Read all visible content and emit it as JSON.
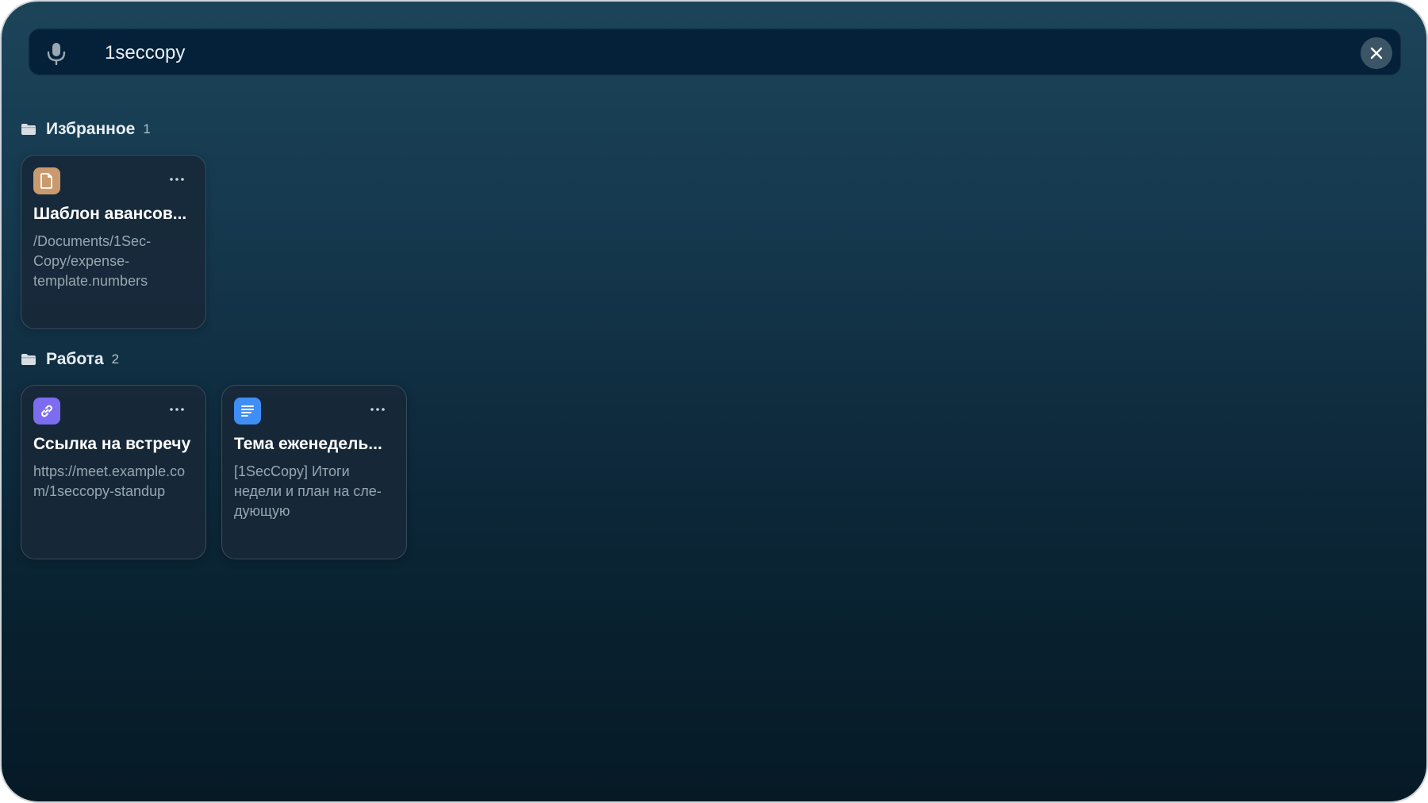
{
  "search": {
    "value": "1seccopy",
    "mic_icon": "microphone-icon",
    "clear_icon": "close-icon"
  },
  "sections": [
    {
      "title": "Избранное",
      "count": "1",
      "icon": "folder-icon",
      "cards": [
        {
          "icon": "document-icon",
          "icon_color": "#c99a6e",
          "title": "Шаблон авансов...",
          "subtitle": "/Documents/1Sec-Copy/expense-template.numbers"
        }
      ]
    },
    {
      "title": "Работа",
      "count": "2",
      "icon": "folder-icon",
      "cards": [
        {
          "icon": "link-icon",
          "icon_color": "#7b6cf0",
          "title": "Ссылка на встречу",
          "subtitle": "https://meet.example.com/1seccopy-standup"
        },
        {
          "icon": "text-lines-icon",
          "icon_color": "#3f8ef5",
          "title": "Тема еженедель...",
          "subtitle": "[1SecCopy] Итоги недели и план на сле-дующую"
        }
      ]
    }
  ],
  "colors": {
    "accent_link": "#7b6cf0",
    "accent_text": "#3f8ef5",
    "accent_doc": "#c99a6e"
  }
}
